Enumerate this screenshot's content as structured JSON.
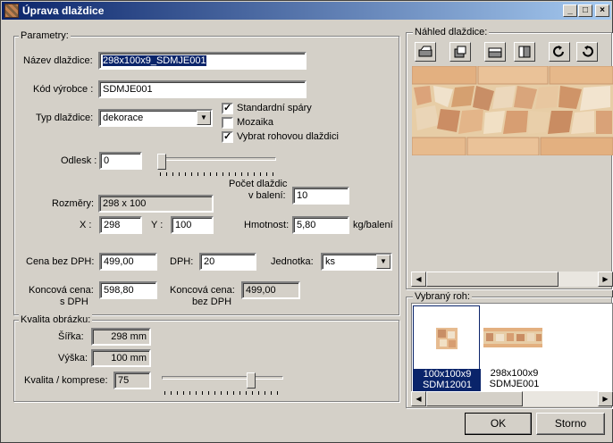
{
  "window": {
    "title": "Úprava dlaždice"
  },
  "parametry": {
    "group_label": "Parametry:",
    "nazev_label": "Název dlaždice:",
    "nazev_value": "298x100x9_SDMJE001",
    "kod_label": "Kód výrobce :",
    "kod_value": "SDMJE001",
    "typ_label": "Typ dlaždice:",
    "typ_value": "dekorace",
    "checkboxes": [
      {
        "label": "Standardní spáry",
        "checked": true
      },
      {
        "label": "Mozaika",
        "checked": false
      },
      {
        "label": "Vybrat rohovou dlaždici",
        "checked": true
      }
    ],
    "odlesk_label": "Odlesk :",
    "odlesk_value": "0",
    "odlesk_level": 0,
    "pocet_label_1": "Počet dlaždic",
    "pocet_label_2": "v balení:",
    "pocet_value": "10",
    "rozmery_label": "Rozměry:",
    "rozmery_value": "298 x 100",
    "x_label": "X :",
    "x_value": "298",
    "y_label": "Y :",
    "y_value": "100",
    "hmotnost_label": "Hmotnost:",
    "hmotnost_value": "5,80",
    "hmotnost_unit": "kg/balení",
    "cena_label": "Cena bez DPH:",
    "cena_value": "499,00",
    "dph_label": "DPH:",
    "dph_value": "20",
    "jednotka_label": "Jednotka:",
    "jednotka_value": "ks",
    "koncova_label_1": "Koncová cena:",
    "koncova_label_2": "s DPH",
    "koncova_value": "598,80",
    "koncova_bez_label_1": "Koncová cena:",
    "koncova_bez_label_2": "bez DPH",
    "koncova_bez_value": "499,00"
  },
  "kvalita": {
    "group_label": "Kvalita obrázku:",
    "sirka_label": "Šířka:",
    "sirka_value": "298 mm",
    "vyska_label": "Výška:",
    "vyska_value": "100 mm",
    "komprese_label": "Kvalita / komprese:",
    "komprese_value": "75",
    "komprese_level": 0.75
  },
  "nahled": {
    "group_label": "Náhled dlaždice:",
    "tools": [
      "rotate-left-icon",
      "rotate-right-icon",
      "flip-horizontal-icon",
      "flip-vertical-icon",
      "redo-icon",
      "undo-icon"
    ]
  },
  "vybrany_roh": {
    "group_label": "Vybraný roh:",
    "items": [
      {
        "line1": "100x100x9",
        "line2": "SDM12001",
        "selected": true
      },
      {
        "line1": "298x100x9",
        "line2": "SDMJE001",
        "selected": false
      }
    ]
  },
  "buttons": {
    "ok": "OK",
    "storno": "Storno"
  },
  "colors": {
    "face": "#d4d0c8",
    "selection": "#0a246a",
    "tile": "#e7cda6"
  }
}
